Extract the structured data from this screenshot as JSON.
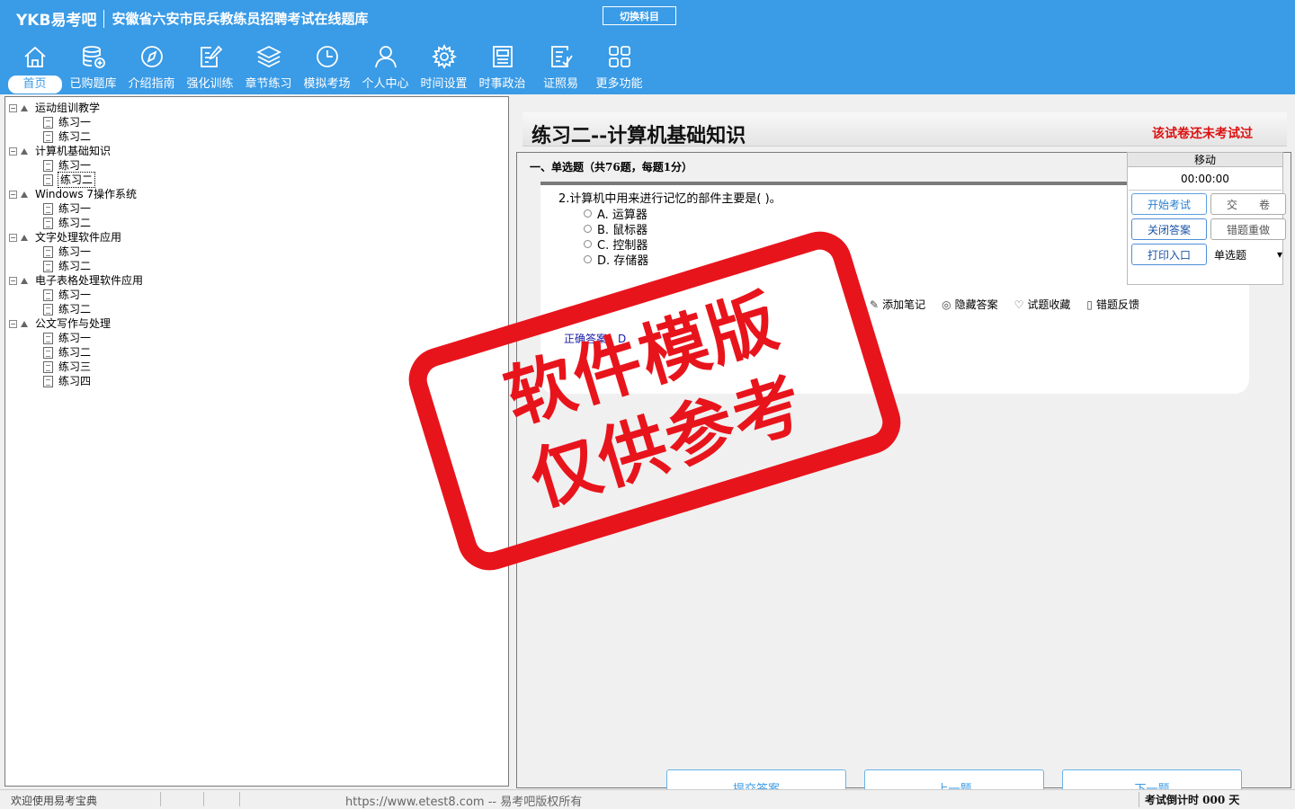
{
  "header": {
    "brand": "YKB易考吧",
    "title": "安徽省六安市民兵教练员招聘考试在线题库",
    "switch_subject": "切换科目"
  },
  "toolbar": [
    {
      "label": "首页",
      "icon": "home-icon"
    },
    {
      "label": "已购题库",
      "icon": "database-icon"
    },
    {
      "label": "介绍指南",
      "icon": "compass-icon"
    },
    {
      "label": "强化训练",
      "icon": "edit-icon"
    },
    {
      "label": "章节练习",
      "icon": "layers-icon"
    },
    {
      "label": "模拟考场",
      "icon": "clock-icon"
    },
    {
      "label": "个人中心",
      "icon": "user-icon"
    },
    {
      "label": "时间设置",
      "icon": "gear-icon"
    },
    {
      "label": "时事政治",
      "icon": "newspaper-icon"
    },
    {
      "label": "证照易",
      "icon": "checklist-icon"
    },
    {
      "label": "更多功能",
      "icon": "grid-icon"
    }
  ],
  "tree": [
    {
      "label": "运动组训教学",
      "children": [
        "练习一",
        "练习二"
      ]
    },
    {
      "label": "计算机基础知识",
      "children": [
        "练习一",
        "练习二"
      ]
    },
    {
      "label": "Windows 7操作系统",
      "children": [
        "练习一",
        "练习二"
      ]
    },
    {
      "label": "文字处理软件应用",
      "children": [
        "练习一",
        "练习二"
      ]
    },
    {
      "label": "电子表格处理软件应用",
      "children": [
        "练习一",
        "练习二"
      ]
    },
    {
      "label": "公文写作与处理",
      "children": [
        "练习一",
        "练习二",
        "练习三",
        "练习四"
      ]
    }
  ],
  "exam": {
    "title": "练习二--计算机基础知识",
    "status": "该试卷还未考试过",
    "section": "一、单选题（共76题，每题1分）",
    "question": "2.计算机中用来进行记忆的部件主要是( )。",
    "options": [
      "A. 运算器",
      "B. 鼠标器",
      "C. 控制器",
      "D. 存储器"
    ],
    "actions": [
      "添加笔记",
      "隐藏答案",
      "试题收藏",
      "错题反馈"
    ],
    "answer_label": "正确答案：",
    "answer_value": "D"
  },
  "side": {
    "move": "移动",
    "timer": "00:00:00",
    "start": "开始考试",
    "submit_paper": "交　　卷",
    "close_answer": "关闭答案",
    "redo_wrong": "错题重做",
    "print": "打印入口",
    "type_select": "单选题"
  },
  "nav": {
    "submit": "提交答案",
    "prev": "上一题",
    "next": "下一题"
  },
  "stamp": {
    "line1": "软件模版",
    "line2": "仅供参考"
  },
  "status": {
    "welcome": "欢迎使用易考宝典",
    "copyright": "https://www.etest8.com -- 易考吧版权所有",
    "countdown": "考试倒计时 000 天"
  }
}
